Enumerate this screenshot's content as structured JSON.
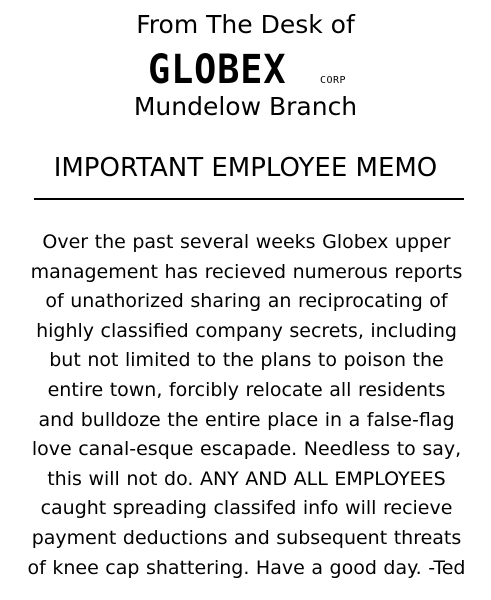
{
  "header": {
    "from_line": "From The Desk of",
    "logo_word": "GLOBEX",
    "logo_corp": "CORP",
    "branch": "Mundelow Branch"
  },
  "memo": {
    "title": "IMPORTANT EMPLOYEE MEMO",
    "lines": [
      "Over the past several weeks Globex upper",
      "management has recieved numerous reports",
      "of unathorized sharing an reciprocating of",
      "highly classified company secrets, including",
      "but not limited to the plans to poison the",
      "entire town, forcibly relocate all residents",
      "and bulldoze the entire place in a false-flag",
      "love canal-esque escapade. Needless to say,",
      "this will not do. ANY AND ALL EMPLOYEES",
      "caught spreading classifed info will recieve",
      "payment deductions and subsequent threats",
      "of knee cap shattering. Have a good day. -Ted"
    ]
  }
}
